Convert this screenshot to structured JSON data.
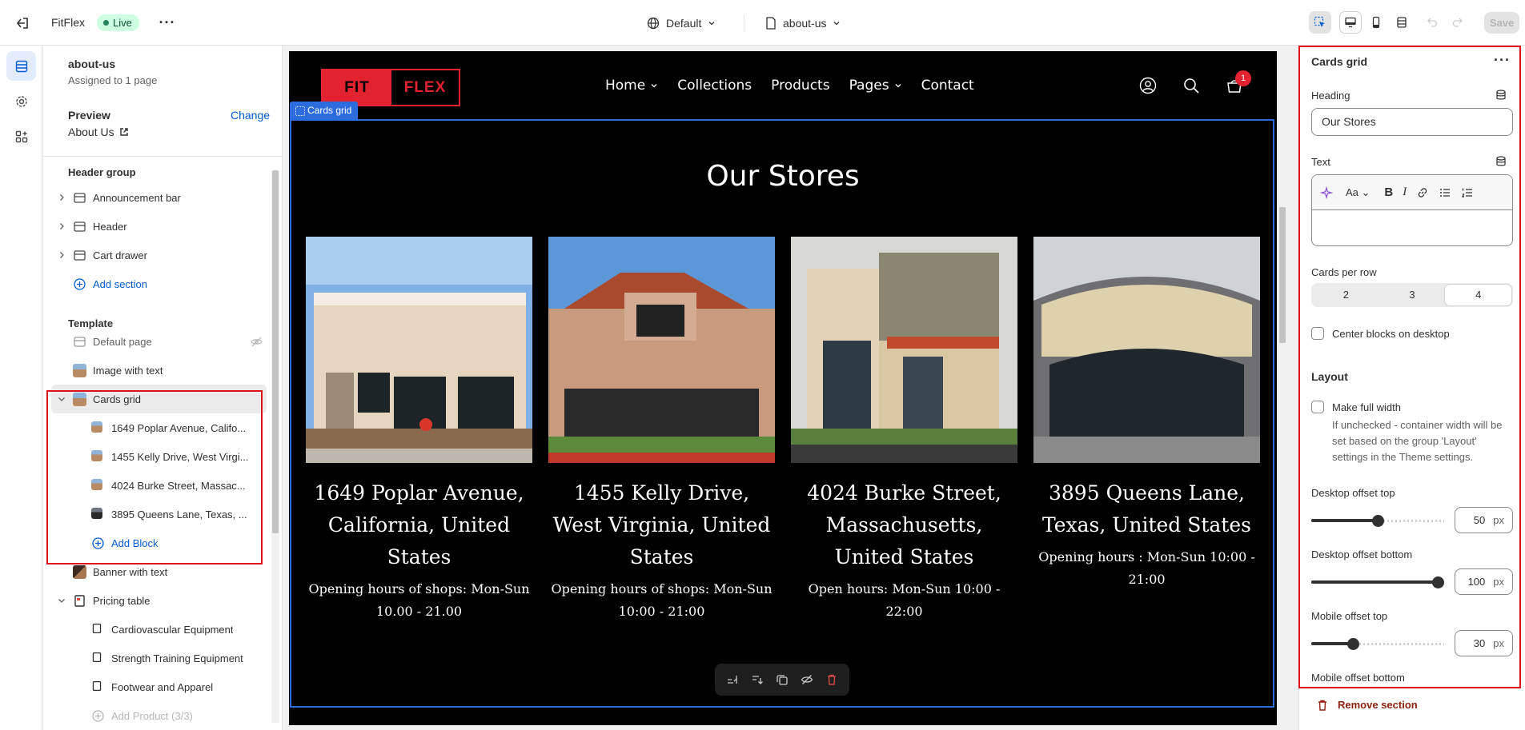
{
  "topbar": {
    "store_name": "FitFlex",
    "live_badge": "Live",
    "theme_select": "Default",
    "page_select": "about-us",
    "save_label": "Save"
  },
  "sidebar": {
    "template_name": "about-us",
    "assigned": "Assigned to 1 page",
    "preview_label": "Preview",
    "change_label": "Change",
    "preview_page": "About Us",
    "header_group_title": "Header group",
    "header_items": [
      "Announcement bar",
      "Header",
      "Cart drawer"
    ],
    "add_section": "Add section",
    "template_title": "Template",
    "template_items": [
      "Default page",
      "Image with text",
      "Cards grid"
    ],
    "cards_blocks": [
      "1649 Poplar Avenue, Califo...",
      "1455 Kelly Drive, West Virgi...",
      "4024 Burke Street, Massac...",
      "3895 Queens Lane, Texas, ..."
    ],
    "add_block": "Add Block",
    "banner": "Banner with text",
    "pricing": "Pricing table",
    "pricing_items": [
      "Cardiovascular Equipment",
      "Strength Training Equipment",
      "Footwear and Apparel"
    ],
    "add_product": "Add Product (3/3)"
  },
  "preview": {
    "logo_left": "FIT",
    "logo_right": "FLEX",
    "nav": [
      "Home",
      "Collections",
      "Products",
      "Pages",
      "Contact"
    ],
    "cart_count": "1",
    "section_tag": "Cards grid",
    "heading": "Our Stores",
    "cards": [
      {
        "title": "1649 Poplar Avenue, California, United States",
        "text": "Opening hours of shops: Mon-Sun 10.00 - 21.00"
      },
      {
        "title": "1455 Kelly Drive, West Virginia, United States",
        "text": "Opening hours of shops: Mon-Sun 10:00 - 21:00"
      },
      {
        "title": "4024 Burke Street, Massachusetts, United States",
        "text": "Open hours: Mon-Sun 10:00 - 22:00"
      },
      {
        "title": "3895 Queens Lane, Texas, United States",
        "text": "Opening hours : Mon-Sun 10:00 - 21:00"
      }
    ]
  },
  "settings": {
    "title": "Cards grid",
    "heading_label": "Heading",
    "heading_value": "Our Stores",
    "text_label": "Text",
    "cards_per_row_label": "Cards per row",
    "cards_per_row_options": [
      "2",
      "3",
      "4"
    ],
    "cards_per_row_selected": "4",
    "center_label": "Center blocks on desktop",
    "layout_title": "Layout",
    "full_width_label": "Make full width",
    "full_width_help": "If unchecked - container width will be set based on the group 'Layout' settings in the Theme settings.",
    "desktop_top_label": "Desktop offset top",
    "desktop_top_value": "50",
    "desktop_bottom_label": "Desktop offset bottom",
    "desktop_bottom_value": "100",
    "mobile_top_label": "Mobile offset top",
    "mobile_top_value": "30",
    "mobile_bottom_label": "Mobile offset bottom",
    "unit": "px",
    "remove_label": "Remove section"
  },
  "slider_levels": {
    "desktop_top": 0.5,
    "desktop_bottom": 1.0,
    "mobile_top": 0.3
  },
  "colors": {
    "accent": "#005bd3",
    "brand_red": "#e2232f",
    "selection_blue": "#2d6cdf",
    "highlight_red": "#e0101a"
  }
}
